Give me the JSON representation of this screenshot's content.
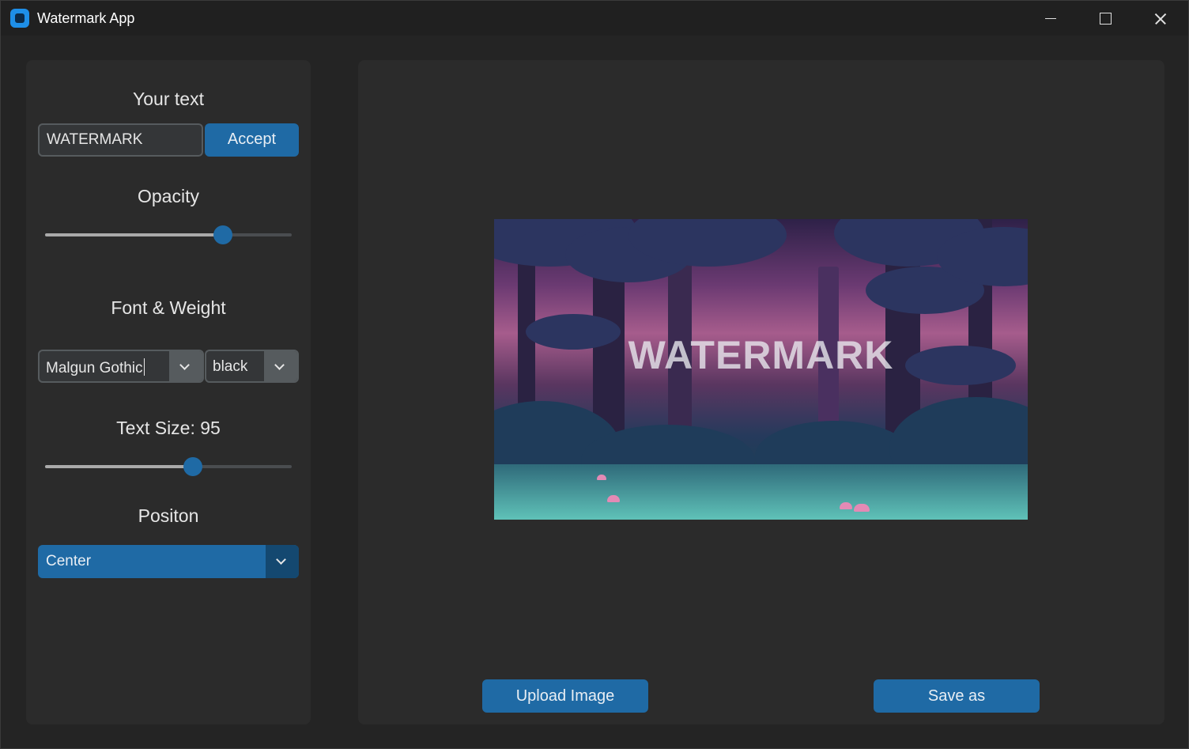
{
  "window": {
    "title": "Watermark App"
  },
  "controls": {
    "text_section": {
      "label": "Your text",
      "input_value": "WATERMARK",
      "accept_label": "Accept"
    },
    "opacity_section": {
      "label": "Opacity",
      "value_fraction": 0.72
    },
    "font_section": {
      "label": "Font & Weight",
      "font_value": "Malgun Gothic",
      "weight_value": "black"
    },
    "size_section": {
      "label": "Text Size: 95",
      "value_fraction": 0.6
    },
    "position_section": {
      "label": "Positon",
      "value": "Center"
    }
  },
  "preview": {
    "watermark_text": "WATERMARK"
  },
  "actions": {
    "upload_label": "Upload Image",
    "save_label": "Save as"
  },
  "colors": {
    "accent": "#1f6aa5",
    "panel": "#2b2b2b",
    "background": "#242424"
  },
  "icons": [
    "app-icon",
    "minimize-icon",
    "maximize-icon",
    "close-icon",
    "chevron-down-icon"
  ]
}
